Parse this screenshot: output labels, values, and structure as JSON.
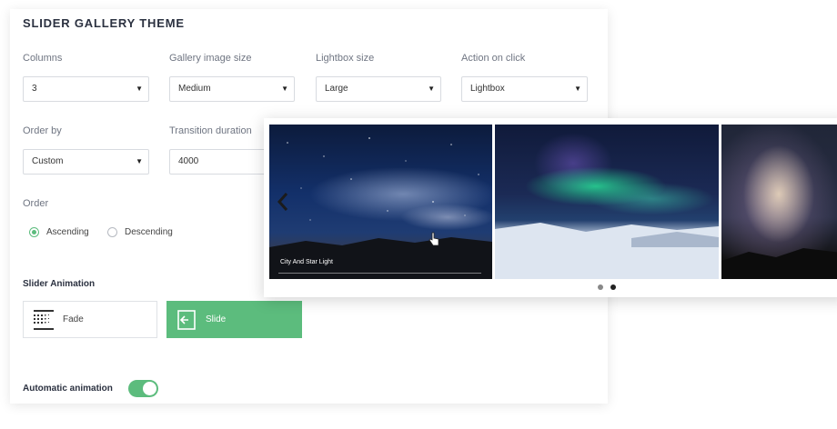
{
  "panel": {
    "title": "SLIDER GALLERY THEME"
  },
  "fields": {
    "columns": {
      "label": "Columns",
      "value": "3"
    },
    "image_size": {
      "label": "Gallery image size",
      "value": "Medium"
    },
    "lightbox_size": {
      "label": "Lightbox size",
      "value": "Large"
    },
    "action_on_click": {
      "label": "Action on click",
      "value": "Lightbox"
    },
    "order_by": {
      "label": "Order by",
      "value": "Custom"
    },
    "transition_duration": {
      "label": "Transition duration",
      "value": "4000"
    }
  },
  "order": {
    "label": "Order",
    "options": [
      "Ascending",
      "Descending"
    ],
    "selected": "Ascending"
  },
  "slider_animation": {
    "title": "Slider Animation",
    "options": [
      "Fade",
      "Slide"
    ],
    "selected": "Slide"
  },
  "automatic_animation": {
    "label": "Automatic animation",
    "enabled": true
  },
  "preview": {
    "caption": "City And Star Light",
    "dots_total": 2,
    "active_dot": 2
  },
  "colors": {
    "accent": "#5cbc7d",
    "title": "#2b3140",
    "label": "#6f7582",
    "border": "#d8dbe0"
  },
  "icons": {
    "select_caret": "caret-down-icon",
    "fade": "fade-icon",
    "slide": "slide-icon",
    "prev": "chevron-left-icon",
    "cursor": "hand-pointer-icon"
  }
}
